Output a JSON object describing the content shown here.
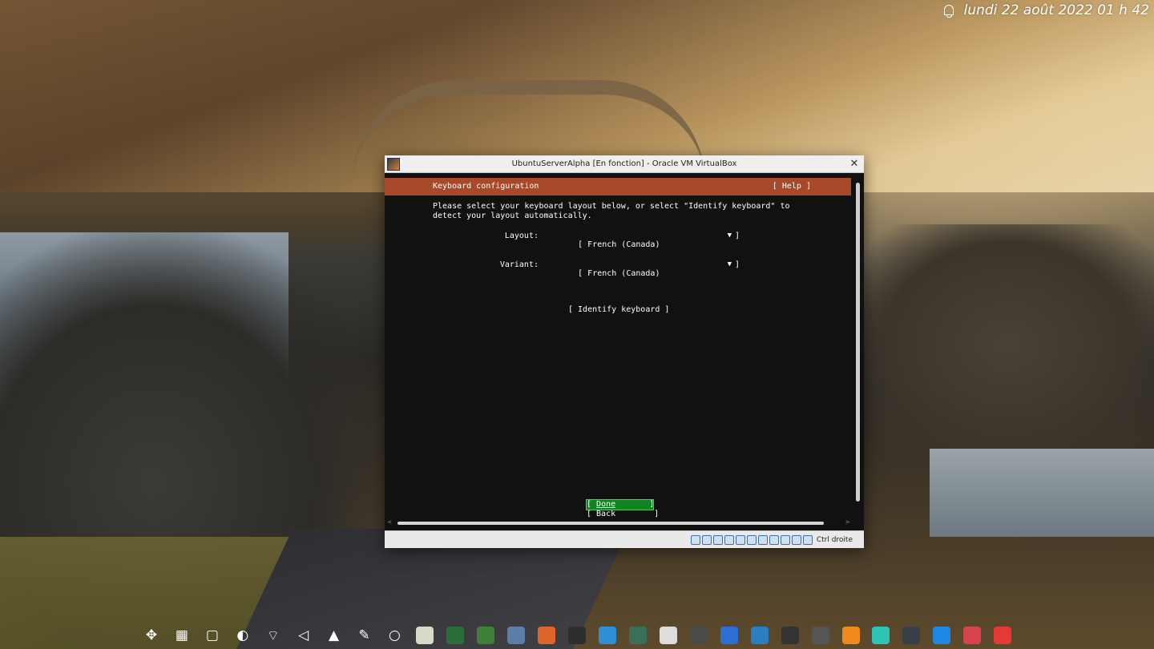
{
  "clock": {
    "text": "lundi 22 août 2022  01 h 42"
  },
  "window": {
    "title": "UbuntuServerAlpha [En fonction] - Oracle VM VirtualBox",
    "close_glyph": "✕"
  },
  "installer": {
    "header_title": "Keyboard configuration",
    "help_label": "[ Help ]",
    "intro_line1": "Please select your keyboard layout below, or select \"Identify keyboard\" to",
    "intro_line2": "detect your layout automatically.",
    "layout_label": "Layout:",
    "layout_value": "[ French (Canada)",
    "variant_label": "Variant:",
    "variant_value": "[ French (Canada)",
    "dropdown_arrow": "▼",
    "bracket_close": "]",
    "identify_label": "[ Identify keyboard ]",
    "done_open": "[ ",
    "done_label": "Done",
    "done_close": "       ]",
    "back_label": "[ Back        ]"
  },
  "statusbar": {
    "host_key": "Ctrl droite"
  },
  "taskbar_icons": [
    "workspaces-icon",
    "app-grid-icon",
    "desktop-icon",
    "night-light-icon",
    "wifi-icon",
    "volume-icon",
    "tray-expand-icon",
    "color-picker-icon",
    "circle-icon",
    "notes-icon",
    "globe-icon",
    "vpn-icon",
    "virtualbox-icon",
    "ubuntu-installer-icon",
    "terminal-icon",
    "file-manager-icon",
    "system-monitor-icon",
    "font-viewer-icon",
    "disks-icon",
    "app-store-icon",
    "writer-icon",
    "gamepad-icon",
    "inkscape-icon",
    "vlc-icon",
    "mail-icon",
    "console-icon",
    "browser-icon",
    "folder-icon",
    "chrome-icon"
  ],
  "colors": {
    "header_bar": "#a84a29",
    "done_button": "#0e8420",
    "screen_bg": "#111111"
  }
}
